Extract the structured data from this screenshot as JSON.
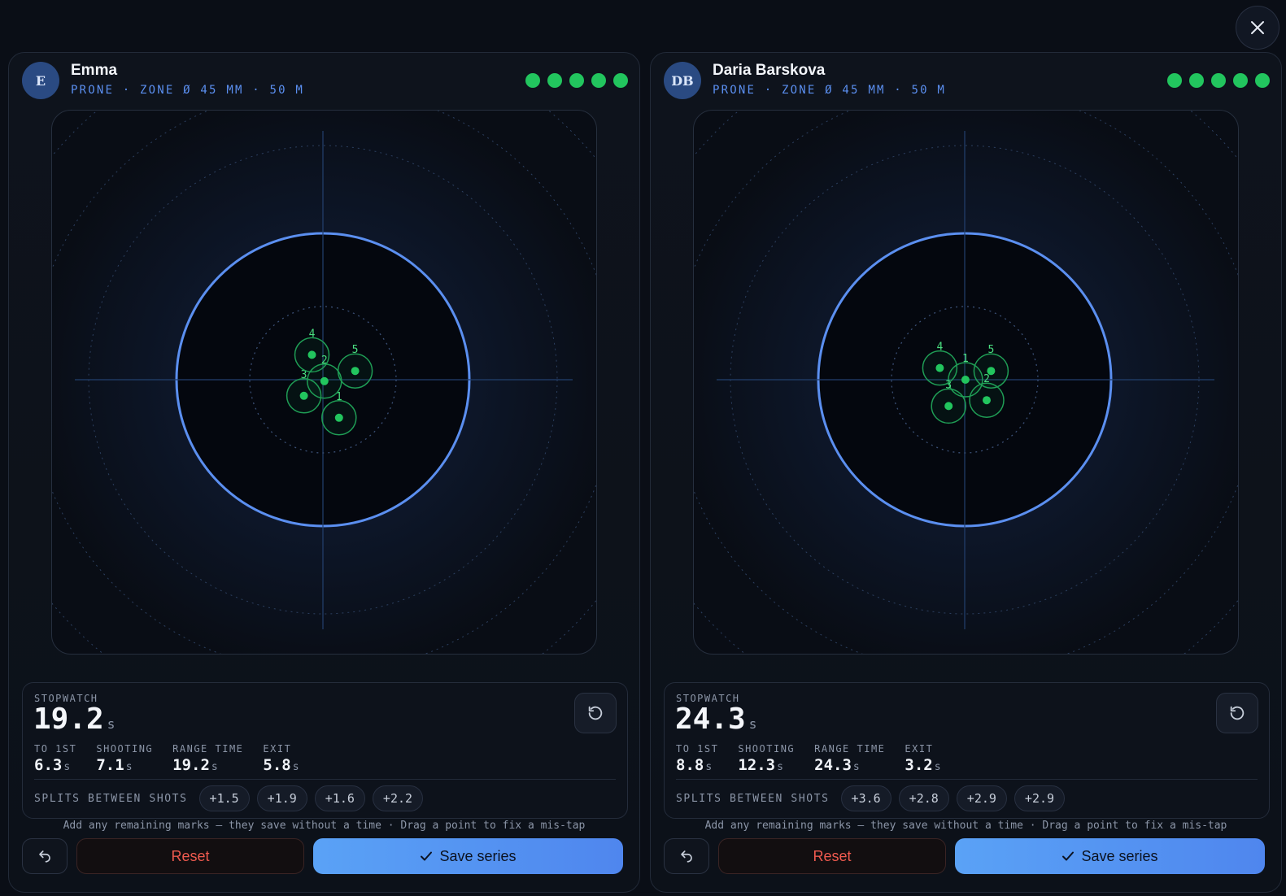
{
  "close_label": "×",
  "colors": {
    "hit": "#22c55e",
    "accent": "#5b8ff0",
    "danger": "#ef5a4f"
  },
  "panels": [
    {
      "avatar": "E",
      "name": "Emma",
      "subtitle": "PRONE · ZONE Ø 45 MM · 50 M",
      "hits": 5,
      "stopwatch": {
        "label": "STOPWATCH",
        "value": "19.2",
        "unit": "s"
      },
      "stats": [
        {
          "label": "TO 1ST",
          "value": "6.3",
          "unit": "s"
        },
        {
          "label": "SHOOTING",
          "value": "7.1",
          "unit": "s"
        },
        {
          "label": "RANGE TIME",
          "value": "19.2",
          "unit": "s"
        },
        {
          "label": "EXIT",
          "value": "5.8",
          "unit": "s"
        }
      ],
      "splits_label": "SPLITS BETWEEN SHOTS",
      "splits": [
        "+1.5",
        "+1.9",
        "+1.6",
        "+2.2"
      ],
      "shots": [
        {
          "n": "1",
          "dx": 0.11,
          "dy": 0.26
        },
        {
          "n": "2",
          "dx": 0.01,
          "dy": 0.01
        },
        {
          "n": "3",
          "dx": -0.13,
          "dy": 0.11
        },
        {
          "n": "4",
          "dx": -0.075,
          "dy": -0.17
        },
        {
          "n": "5",
          "dx": 0.22,
          "dy": -0.06
        }
      ],
      "hint": "Add any remaining marks — they save without a time · Drag a point to fix a mis-tap",
      "undo_icon": "undo-icon",
      "reset_label": "Reset",
      "save_label": "Save series"
    },
    {
      "avatar": "DB",
      "name": "Daria Barskova",
      "subtitle": "PRONE · ZONE Ø 45 MM · 50 M",
      "hits": 5,
      "stopwatch": {
        "label": "STOPWATCH",
        "value": "24.3",
        "unit": "s"
      },
      "stats": [
        {
          "label": "TO 1ST",
          "value": "8.8",
          "unit": "s"
        },
        {
          "label": "SHOOTING",
          "value": "12.3",
          "unit": "s"
        },
        {
          "label": "RANGE TIME",
          "value": "24.3",
          "unit": "s"
        },
        {
          "label": "EXIT",
          "value": "3.2",
          "unit": "s"
        }
      ],
      "splits_label": "SPLITS BETWEEN SHOTS",
      "splits": [
        "+3.6",
        "+2.8",
        "+2.9",
        "+2.9"
      ],
      "shots": [
        {
          "n": "1",
          "dx": 0.005,
          "dy": 0.0
        },
        {
          "n": "2",
          "dx": 0.15,
          "dy": 0.14
        },
        {
          "n": "3",
          "dx": -0.11,
          "dy": 0.18
        },
        {
          "n": "4",
          "dx": -0.17,
          "dy": -0.08
        },
        {
          "n": "5",
          "dx": 0.18,
          "dy": -0.06
        }
      ],
      "hint": "Add any remaining marks — they save without a time · Drag a point to fix a mis-tap",
      "undo_icon": "undo-icon",
      "reset_label": "Reset",
      "save_label": "Save series"
    }
  ]
}
